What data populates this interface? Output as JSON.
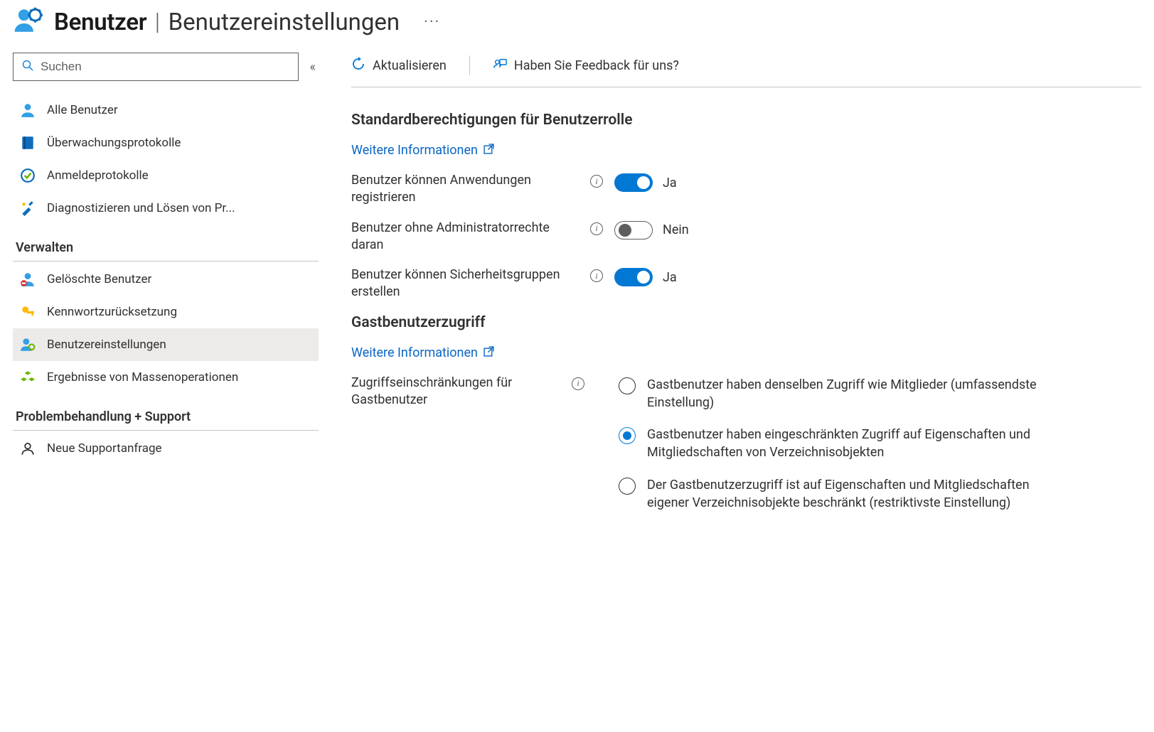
{
  "header": {
    "title_bold": "Benutzer",
    "separator": "|",
    "subtitle": "Benutzereinstellungen",
    "more": "···"
  },
  "sidebar": {
    "search_placeholder": "Suchen",
    "collapse": "«",
    "top_items": [
      {
        "label": "Alle Benutzer"
      },
      {
        "label": "Überwachungsprotokolle"
      },
      {
        "label": "Anmeldeprotokolle"
      },
      {
        "label": "Diagnostizieren und Lösen von Pr..."
      }
    ],
    "group1_title": "Verwalten",
    "group1_items": [
      {
        "label": "Gelöschte Benutzer"
      },
      {
        "label": "Kennwortzurücksetzung"
      },
      {
        "label": "Benutzereinstellungen"
      },
      {
        "label": "Ergebnisse von Massenoperationen"
      }
    ],
    "group2_title": "Problembehandlung + Support",
    "group2_items": [
      {
        "label": "Neue Supportanfrage"
      }
    ]
  },
  "toolbar": {
    "refresh": "Aktualisieren",
    "feedback": "Haben Sie Feedback für uns?"
  },
  "sections": {
    "default_perms_title": "Standardberechtigungen für Benutzerrolle",
    "more_info": "Weitere Informationen",
    "settings": [
      {
        "label": "Benutzer können Anwendungen registrieren",
        "on": true,
        "text": "Ja"
      },
      {
        "label": "Benutzer ohne Administratorrechte daran",
        "on": false,
        "text": "Nein"
      },
      {
        "label": "Benutzer können Sicherheitsgruppen erstellen",
        "on": true,
        "text": "Ja"
      }
    ],
    "guest_title": "Gastbenutzerzugriff",
    "guest_label": "Zugriffseinschränkungen für Gastbenutzer",
    "guest_options": [
      {
        "label": "Gastbenutzer haben denselben Zugriff wie Mitglieder (umfassendste Einstellung)",
        "selected": false
      },
      {
        "label": "Gastbenutzer haben eingeschränkten Zugriff auf Eigenschaften und Mitgliedschaften von Verzeichnisobjekten",
        "selected": true
      },
      {
        "label": "Der Gastbenutzerzugriff ist auf Eigenschaften und Mitgliedschaften eigener Verzeichnisobjekte beschränkt (restriktivste Einstellung)",
        "selected": false
      }
    ]
  }
}
